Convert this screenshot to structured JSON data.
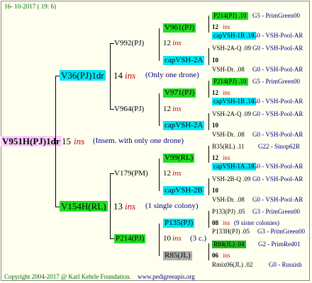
{
  "header": {
    "date": "16- 10-2017 ( 19:  6)"
  },
  "root": {
    "name": "V951H(PJ)1dr",
    "year": "15",
    "ins": "ins",
    "note": "(Insem. with only one drone)"
  },
  "gen1": [
    {
      "name": "V36(PJ)1dr",
      "year": "14",
      "ins": "ins",
      "note": "(Only one drone)"
    },
    {
      "name": "V154H(RL)",
      "year": "13",
      "ins": "ins",
      "note": "(1 single colony)"
    }
  ],
  "gen2": [
    {
      "name": "V992(PJ)",
      "year": "12",
      "ins": "ins"
    },
    {
      "name": "V964(PJ)",
      "year": "12",
      "ins": "ins"
    },
    {
      "name": "V179(PM)",
      "year": "12",
      "ins": "ins"
    },
    {
      "name": "P214(PJ)",
      "year": "10",
      "ins": "ins",
      "note": "(3 c.)"
    }
  ],
  "gen3": [
    {
      "name": "V961(PJ)",
      "year": "12",
      "ins": "ins"
    },
    {
      "name": "capVSH-2A",
      "year": "10",
      "ins": ""
    },
    {
      "name": "V971(PJ)",
      "year": "12",
      "ins": "ins"
    },
    {
      "name": "capVSH-2A",
      "year": "10",
      "ins": ""
    },
    {
      "name": "V99(RL)",
      "year": "12",
      "ins": "ins"
    },
    {
      "name": "capVSH-2B",
      "year": "10",
      "ins": ""
    },
    {
      "name": "P135(PJ)",
      "year": "08",
      "ins": "ins",
      "note": "(9 sister colonies)"
    },
    {
      "name": "R85(JL)",
      "year": "06",
      "ins": "ins"
    }
  ],
  "gen4": [
    {
      "name": "P214(PJ) .10",
      "src": "G5 - PrimGreen00"
    },
    {
      "name": "capVSH-1B .10",
      "src": "G0 - VSH-Pool-AR"
    },
    {
      "name": "VSH-2A-Q .09",
      "src": "G0 - VSH-Pool-AR"
    },
    {
      "name": "VSH-Dr. .08",
      "src": "G0 - VSH-Pool-AR"
    },
    {
      "name": "P214(PJ) .10",
      "src": "G5 - PrimGreen00"
    },
    {
      "name": "capVSH-1B .10",
      "src": "G0 - VSH-Pool-AR"
    },
    {
      "name": "VSH-2A-Q .09",
      "src": "G0 - VSH-Pool-AR"
    },
    {
      "name": "VSH-Dr. .08",
      "src": "G0 - VSH-Pool-AR"
    },
    {
      "name": "B35(RL) .11",
      "src": "G22 - Sinop62R"
    },
    {
      "name": "capVSH-1A .10",
      "src": "G0 - VSH-Pool-AR"
    },
    {
      "name": "VSH-2B-Q .09",
      "src": "G0 - VSH-Pool-AR"
    },
    {
      "name": "VSH-Dr. .08",
      "src": "G0 - VSH-Pool-AR"
    },
    {
      "name": "P133(PJ) .05",
      "src": "G3 - PrimGreen00"
    },
    {
      "name": "P133H(PJ) .05",
      "src": "G3 - PrimGreen00"
    },
    {
      "name": "R84(JL) .04",
      "src": "G2 - PrimRed01"
    },
    {
      "name": "Rmix06(JL) .02",
      "src": "G0 - Russish"
    }
  ],
  "footer": {
    "copyright": "Copyright 2004-2017 @ Karl Kehrle Foundation.",
    "url": "www.pedigreeapis.org"
  }
}
